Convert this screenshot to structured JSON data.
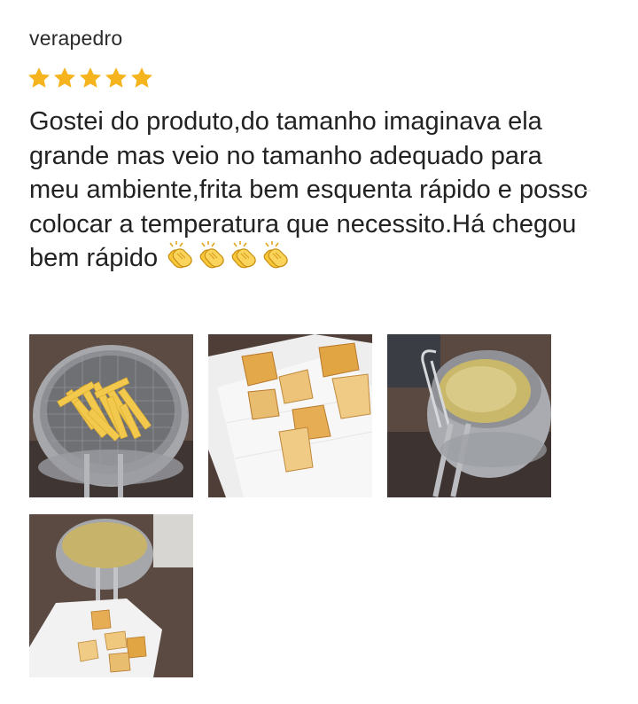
{
  "review": {
    "username": "verapedro",
    "rating": 5,
    "rating_max": 5,
    "star_color": "#F5B41D",
    "text": "Gostei do produto,do tamanho imaginava ela grande mas veio no tamanho adequado para meu ambiente,frita bem esquenta rápido e posso colocar a temperatura que necessito.Há chegou bem rápido",
    "emoji": [
      "clapping-hands",
      "clapping-hands",
      "clapping-hands",
      "clapping-hands"
    ],
    "photos": [
      {
        "name": "photo-fries-in-basket"
      },
      {
        "name": "photo-fried-pastries-on-paper"
      },
      {
        "name": "photo-fryer-with-oil"
      },
      {
        "name": "photo-fryer-and-pastries"
      }
    ]
  }
}
